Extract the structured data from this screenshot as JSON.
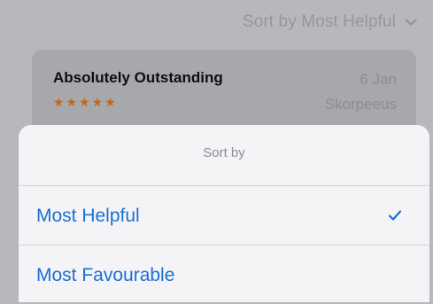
{
  "sort_header": {
    "label": "Sort by Most Helpful",
    "icon": "chevron-down-icon"
  },
  "review": {
    "title": "Absolutely Outstanding",
    "stars": "★★★★★",
    "rating": 5,
    "date": "6 Jan",
    "author": "Skorpeeus"
  },
  "sort_sheet": {
    "title": "Sort by",
    "options": [
      {
        "label": "Most Helpful",
        "selected": true,
        "icon": "checkmark-icon"
      },
      {
        "label": "Most Favourable",
        "selected": false
      }
    ]
  },
  "colors": {
    "accent": "#1b6fd6",
    "stars": "#c96710",
    "background_dim": "#b7b8bb",
    "card_dim": "#a7a8ac",
    "sheet": "#f4f4f6"
  }
}
